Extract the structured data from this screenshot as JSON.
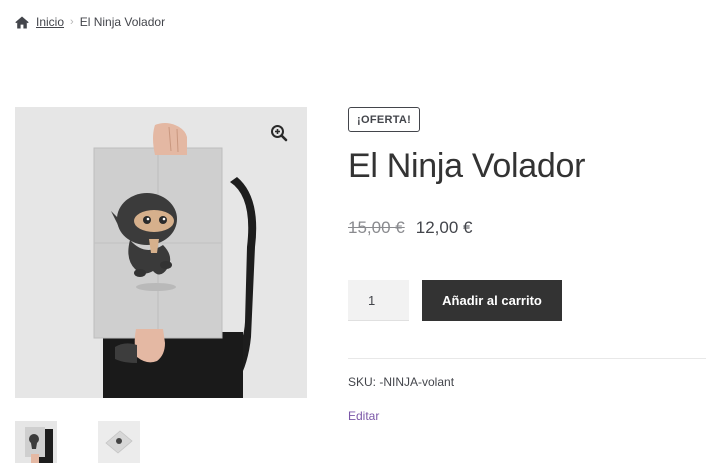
{
  "breadcrumb": {
    "home_icon": "home-icon",
    "home_label": "Inicio",
    "separator": "›",
    "current": "El Ninja Volador"
  },
  "gallery": {
    "zoom_icon": "zoom-in-icon",
    "thumbnails": [
      "ninja-poster-held",
      "ninja-poster-flat"
    ]
  },
  "product": {
    "badge": "¡OFERTA!",
    "title": "El Ninja Volador",
    "price_regular": "15,00 €",
    "price_sale": "12,00 €",
    "quantity": "1",
    "add_to_cart": "Añadir al carrito",
    "sku": "SKU: -NINJA-volant",
    "edit_label": "Editar"
  },
  "colors": {
    "text": "#43454b",
    "button_bg": "#333333",
    "link": "#7b57a8"
  }
}
